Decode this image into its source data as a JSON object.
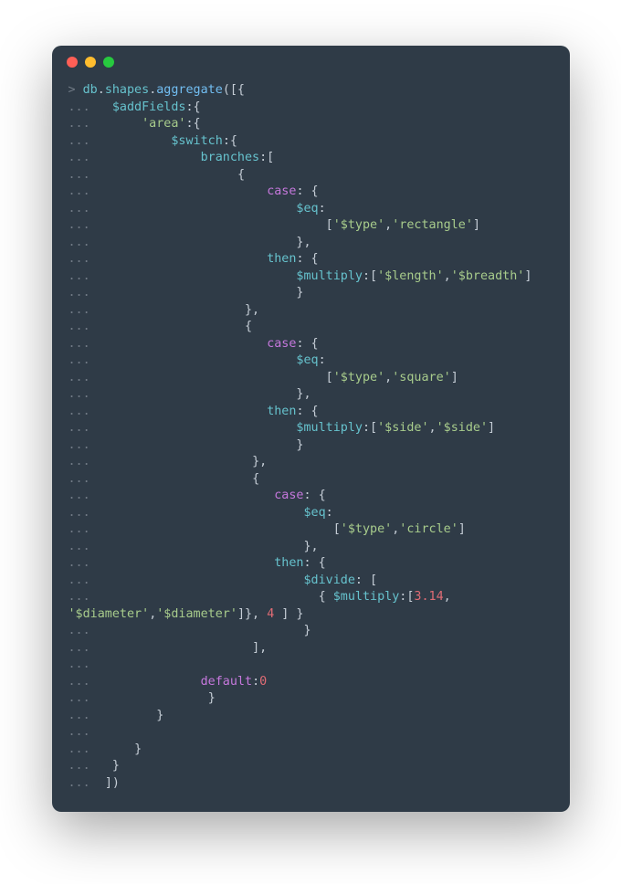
{
  "prompt": "> ",
  "cont": "... ",
  "db": "db",
  "dot": ".",
  "shapes": "shapes",
  "aggregate": "aggregate",
  "openCall": "([{",
  "addFields": "$addFields",
  "colon": ":",
  "obrace": "{",
  "area": "'area'",
  "switch": "$switch",
  "branches": "branches",
  "obracket": "[",
  "case": "case",
  "eq": "$eq",
  "then": "then",
  "multiply": "$multiply",
  "divide": "$divide",
  "type": "'$type'",
  "rect": "'rectangle'",
  "square": "'square'",
  "circle": "'circle'",
  "length": "'$length'",
  "breadth": "'$breadth'",
  "side": "'$side'",
  "diameter": "'$diameter'",
  "c_3_14": "3.14",
  "c_4": "4",
  "default": "default",
  "c_0": "0",
  "cbrace": "}",
  "cbracket": "]",
  "comma": ",",
  "closeCall": "])",
  "cbraceComma": "},",
  "cbracketComma": "],",
  "colonObrace": ":{",
  "colonObracket": ":[",
  "colonSpaceObrace": ": {",
  "colonSpaceObracket": ": [",
  "closeMultiSeg": "]}, ",
  "closeDivideSeg": " ] }"
}
